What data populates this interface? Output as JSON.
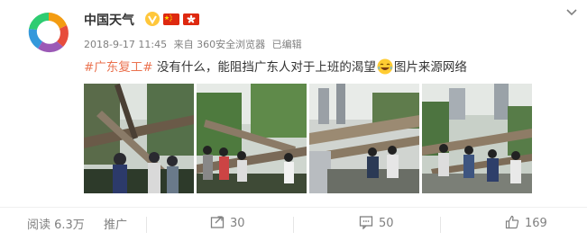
{
  "account": {
    "name": "中国天气",
    "verified_icon": "verified-v-icon",
    "flags": [
      "china-flag-icon",
      "hong-kong-flag-icon"
    ]
  },
  "post": {
    "timestamp": "2018-9-17 11:45",
    "source": "来自 360安全浏览器",
    "edited": "已编辑",
    "hashtag": "#广东复工#",
    "text_main": " 没有什么，能阻挡广东人对于上班的渴望",
    "text_tail": "图片来源网络",
    "emoji": "laughing-emoji-icon",
    "images": [
      {
        "name": "photo-fallen-trees-1"
      },
      {
        "name": "photo-fallen-trees-2"
      },
      {
        "name": "photo-fallen-trees-3"
      },
      {
        "name": "photo-fallen-trees-4"
      }
    ]
  },
  "footer": {
    "views": "阅读 6.3万",
    "promote": "推广",
    "reposts": "30",
    "comments": "50",
    "likes": "169"
  },
  "colors": {
    "hashtag": "#eb7350",
    "meta_text": "#808080",
    "verified": "#ffc73b",
    "flag_red": "#de2910"
  }
}
